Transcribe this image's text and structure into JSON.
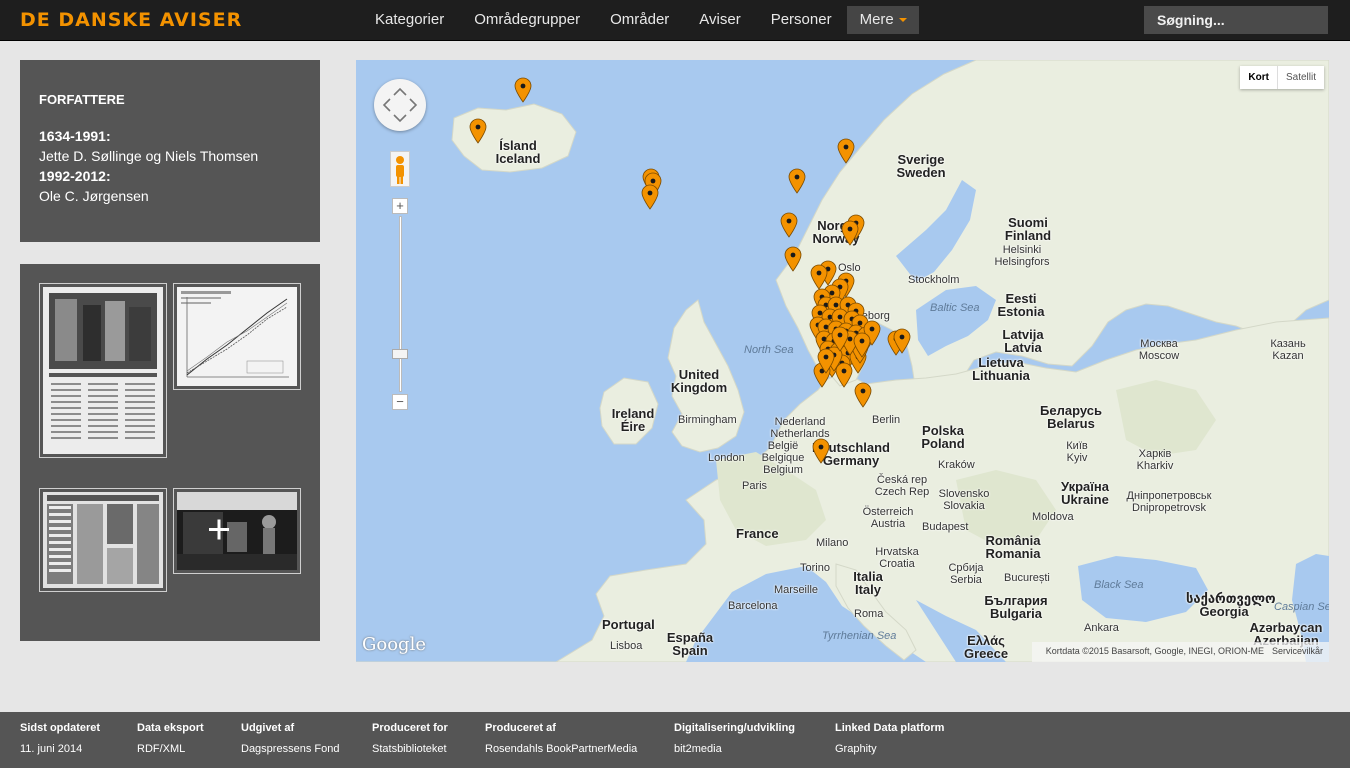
{
  "header": {
    "logo": "DE DANSKE AVISER",
    "nav": [
      "Kategorier",
      "Områdegrupper",
      "Områder",
      "Aviser",
      "Personer"
    ],
    "more_label": "Mere",
    "search_placeholder": "Søgning..."
  },
  "authors": {
    "heading": "FORFATTERE",
    "entries": [
      {
        "period": "1634-1991:",
        "names": "Jette D. Søllinge og Niels Thomsen"
      },
      {
        "period": "1992-2012:",
        "names": "Ole C. Jørgensen"
      }
    ]
  },
  "map": {
    "map_types": [
      "Kort",
      "Satellit"
    ],
    "selected_type": "Kort",
    "zoom_in": "+",
    "zoom_out": "−",
    "google": "Google",
    "attribution": "Kortdata ©2015 Basarsoft, Google, INEGI, ORION-ME",
    "terms": "Servicevilkår",
    "labels": {
      "island": "Ísland\nIceland",
      "sverige": "Sverige\nSweden",
      "norge": "Norge\nNorway",
      "suomi": "Suomi\nFinland",
      "helsinki": "Helsinki\nHelsingfors",
      "oslo": "Oslo",
      "stockholm": "Stockholm",
      "eesti": "Eesti\nEstonia",
      "baltic": "Baltic Sea",
      "latvija": "Latvija\nLatvia",
      "lietuva": "Lietuva\nLithuania",
      "moskva": "Москва\nMoscow",
      "kazan": "Казань\nKazan",
      "north_sea": "North Sea",
      "uk": "United\nKingdom",
      "ireland": "Ireland\nÉire",
      "birmingham": "Birmingham",
      "london": "London",
      "netherlands": "Nederland\nNetherlands",
      "belgium": "België\nBelgique\nBelgium",
      "deutschland": "Deutschland\nGermany",
      "berlin": "Berlin",
      "polska": "Polska\nPoland",
      "belarus": "Беларусь\nBelarus",
      "kyiv": "Київ\nKyiv",
      "kharkiv": "Харків\nKharkiv",
      "paris": "Paris",
      "france": "France",
      "czech": "Česká rep\nCzech Rep",
      "krakow": "Kraków",
      "slovensko": "Slovensko\nSlovakia",
      "ukraina": "Україна\nUkraine",
      "dnipro": "Дніпропетровськ\nDnipropetrovsk",
      "osterreich": "Österreich\nAustria",
      "moldova": "Moldova",
      "budapest": "Budapest",
      "milano": "Milano",
      "hrvatska": "Hrvatska\nCroatia",
      "romania": "România\nRomania",
      "torino": "Torino",
      "srbija": "Србија\nSerbia",
      "bucuresti": "București",
      "black_sea": "Black Sea",
      "marseille": "Marseille",
      "italia": "Italia\nItaly",
      "bulgaria": "България\nBulgaria",
      "georgia": "საქართველო\nGeorgia",
      "caspian": "Caspian Se",
      "barcelona": "Barcelona",
      "portugal": "Portugal",
      "espana": "España\nSpain",
      "tyrrhenian": "Tyrrhenian Sea",
      "roma": "Roma",
      "lisboa": "Lisboa",
      "ankara": "Ankara",
      "azerbaijan": "Azərbaycan\nAzerbaijan",
      "greece": "Ελλάς\nGreece",
      "goteborg": "Göteborg"
    }
  },
  "footer": [
    {
      "heading": "Sidst opdateret",
      "value": "11. juni 2014"
    },
    {
      "heading": "Data eksport",
      "value": "RDF/XML"
    },
    {
      "heading": "Udgivet af",
      "value": "Dagspressens Fond"
    },
    {
      "heading": "Produceret for",
      "value": "Statsbiblioteket"
    },
    {
      "heading": "Produceret af",
      "value": "Rosendahls BookPartnerMedia"
    },
    {
      "heading": "Digitalisering/udvikling",
      "value": "bit2media"
    },
    {
      "heading": "Linked Data platform",
      "value": "Graphity"
    }
  ],
  "colors": {
    "accent": "#f39200",
    "header_bg": "#1e1e1e",
    "panel_bg": "#555555",
    "water": "#a8c9ef",
    "land": "#eaeee0"
  }
}
